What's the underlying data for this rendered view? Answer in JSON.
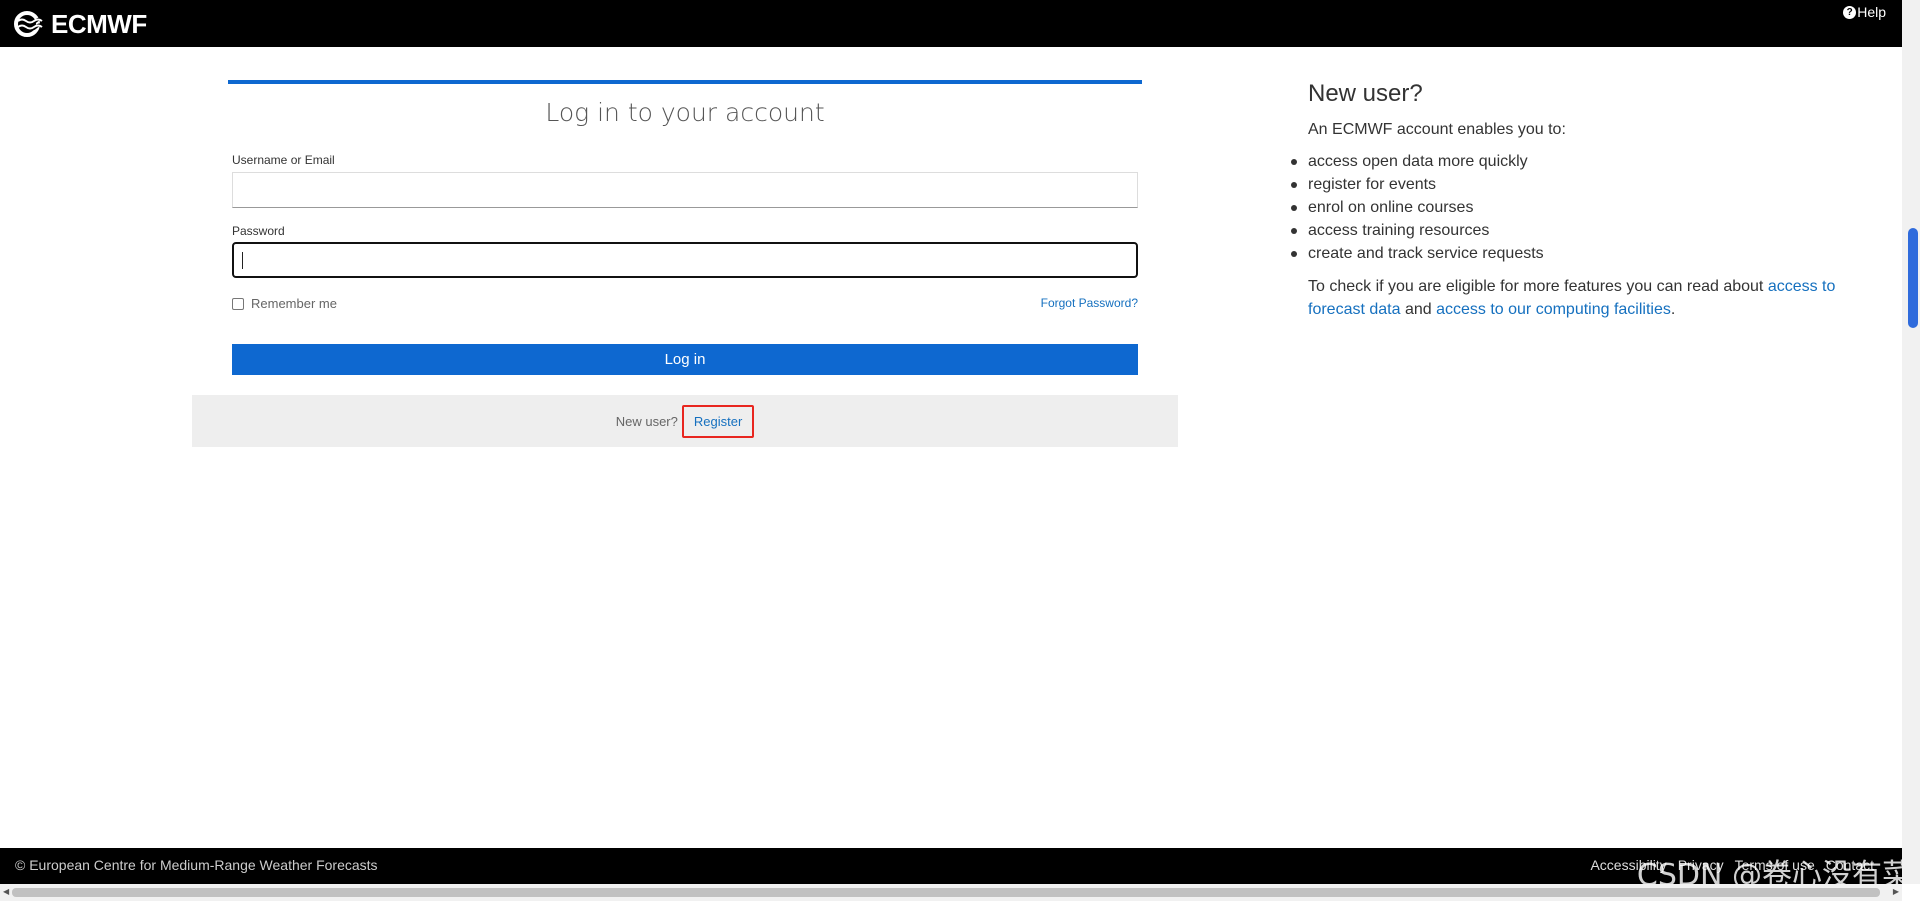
{
  "header": {
    "logo_text": "ECMWF",
    "help_label": "Help"
  },
  "login": {
    "title": "Log in to your account",
    "username_label": "Username or Email",
    "username_value": "",
    "password_label": "Password",
    "password_value": "",
    "remember_label": "Remember me",
    "forgot_label": "Forgot Password?",
    "login_button": "Log in",
    "new_user_text": "New user?",
    "register_link": "Register"
  },
  "new_user_panel": {
    "heading": "New user?",
    "intro": "An ECMWF account enables you to:",
    "items": [
      "access open data more quickly",
      "register for events",
      "enrol on online courses",
      "access training resources",
      "create and track service requests"
    ],
    "eligibility_prefix": "To check if you are eligible for more features you can read about ",
    "link_forecast": "access to forecast data",
    "and_text": " and ",
    "link_computing": "access to our computing facilities",
    "suffix": "."
  },
  "footer": {
    "copyright": "© European Centre for Medium-Range Weather Forecasts",
    "links": [
      "Accessibility",
      "Privacy",
      "Terms of use",
      "Contact"
    ]
  },
  "watermark": "CSDN @卷心没有菜",
  "colors": {
    "brand_blue": "#0e68d0",
    "link_blue": "#1570bf",
    "highlight_red": "#e8261f"
  }
}
